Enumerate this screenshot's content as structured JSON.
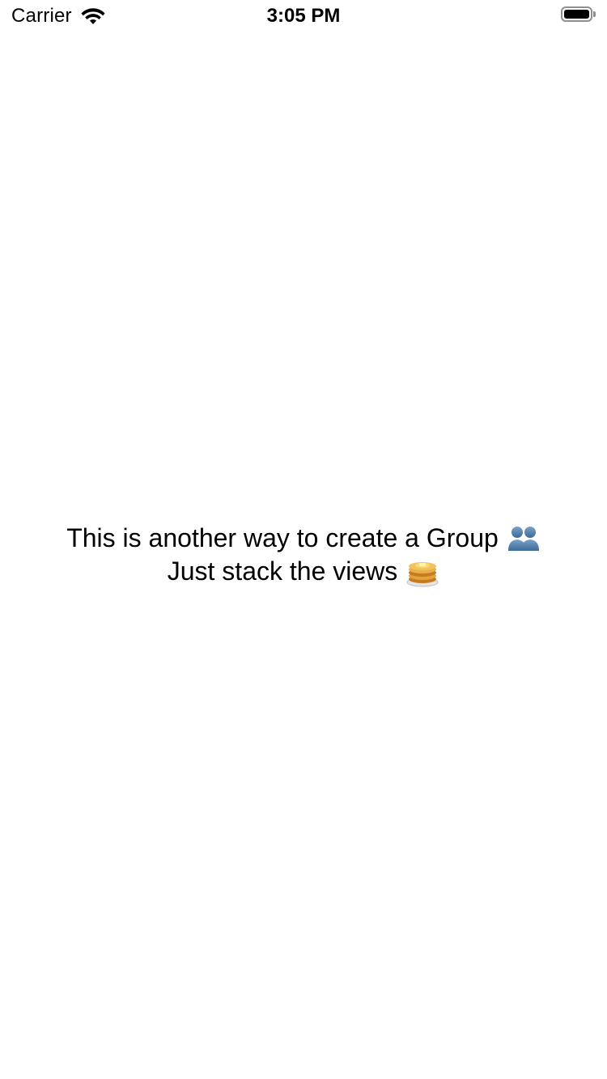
{
  "status_bar": {
    "carrier": "Carrier",
    "time": "3:05 PM",
    "wifi_icon": "wifi-icon",
    "battery_icon": "battery-icon",
    "battery_level": 1.0
  },
  "content": {
    "line1": {
      "text": "This is another way to create a Group",
      "emoji": "busts-in-silhouette-icon"
    },
    "line2": {
      "text": "Just stack the views",
      "emoji": "pancakes-icon"
    }
  },
  "colors": {
    "background": "#ffffff",
    "text": "#000000",
    "battery_outline": "#8e8e93",
    "group_emoji": "#4a7aa8",
    "pancake": "#e8a93a"
  }
}
